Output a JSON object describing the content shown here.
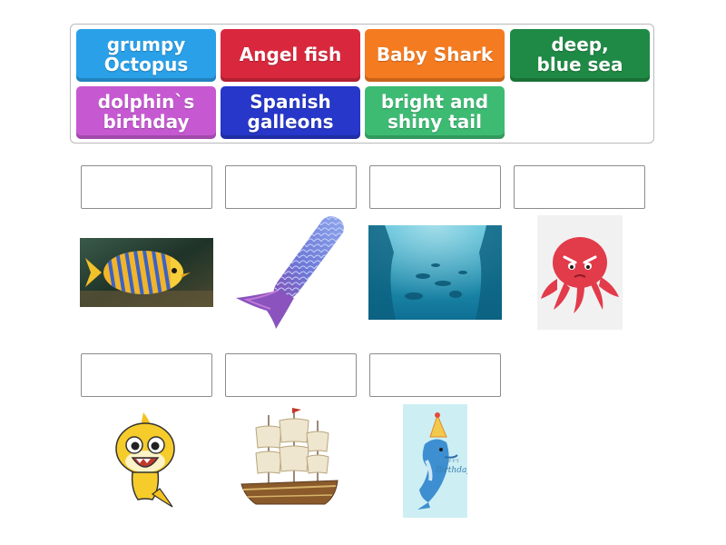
{
  "tiles": [
    {
      "label": "grumpy\nOctopus",
      "color": "#2aa0e8"
    },
    {
      "label": "Angel fish",
      "color": "#d9283d"
    },
    {
      "label": "Baby Shark",
      "color": "#f57b20"
    },
    {
      "label": "deep,\nblue sea",
      "color": "#1f8a45"
    },
    {
      "label": "dolphin`s\nbirthday",
      "color": "#c659d2"
    },
    {
      "label": "Spanish\ngalleons",
      "color": "#2637c9"
    },
    {
      "label": "bright and\nshiny tail",
      "color": "#3dbb73"
    }
  ],
  "card_text": {
    "happy": "HAPPY",
    "birthday": "Birthday"
  }
}
